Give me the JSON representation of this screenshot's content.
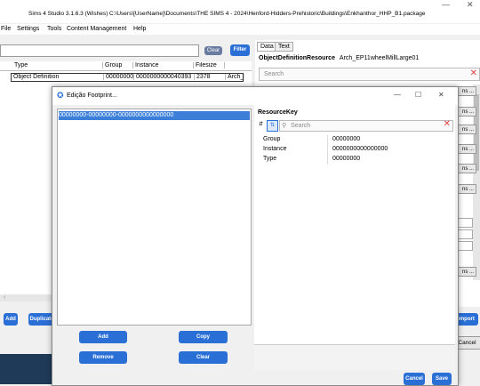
{
  "app": {
    "title": "Sims 4 Studio 3.1.6.3 (Wishes)  C:\\Users\\[UserName]\\Documents\\THE SIMS 4 - 2024\\Henford-Hidders-Prehistoric\\Buildings\\Enkhanthor_HHP_B1.package",
    "menu": [
      "File",
      "Settings",
      "Tools",
      "Content Management",
      "Help"
    ]
  },
  "toolbar": {
    "clear_label": "Clear",
    "filter_label": "Filter"
  },
  "grid": {
    "columns": [
      "Type",
      "Group",
      "Instance",
      "Filesize",
      ""
    ],
    "rows": [
      [
        "Object Definition",
        "00000000",
        "0000000000040393",
        "2378",
        "Arch_E"
      ]
    ]
  },
  "bottom_buttons": {
    "add": "Add",
    "duplicate": "Duplicate",
    "import": "Import",
    "cancel": "Cancel"
  },
  "right_panel": {
    "tabs": [
      "Data",
      "Text"
    ],
    "header_type": "ObjectDefinitionResource",
    "header_name": "Arch_EP11wheelMillLarge01",
    "search_placeholder": "Search",
    "side_buttons": [
      "ns ...",
      "ns ...",
      "ns ...",
      "ns ...",
      "ns ...",
      "ns ..."
    ]
  },
  "footprint_dialog": {
    "title": "Edição Footprint...",
    "list_items": [
      "00000000-00000000-0000000000000000"
    ],
    "buttons": {
      "add": "Add",
      "copy": "Copy",
      "remove": "Remove",
      "clear": "Clear"
    },
    "footer": {
      "cancel": "Cancel",
      "save": "Save"
    }
  },
  "resource_key": {
    "title": "ResourceKey",
    "search_placeholder": "Search",
    "rows": [
      {
        "label": "Group",
        "value": "00000000"
      },
      {
        "label": "Instance",
        "value": "0000000000000000"
      },
      {
        "label": "Type",
        "value": "00000000"
      }
    ]
  },
  "colors": {
    "accent": "#2a6fd6",
    "selection": "#3b7fd9",
    "titlebar": "#ffffff"
  }
}
